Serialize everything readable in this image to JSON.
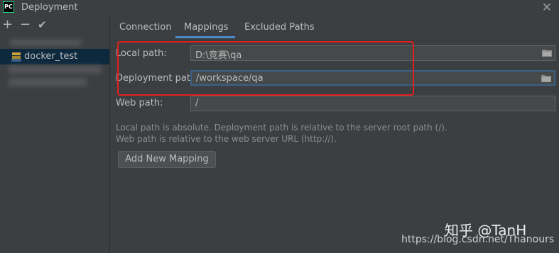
{
  "window": {
    "title": "Deployment",
    "app_icon_text": "PC"
  },
  "left_toolbar": {
    "add": "+",
    "remove": "−",
    "check": "✔"
  },
  "servers": [
    {
      "name": "docker_test",
      "icon": "sftp-icon"
    }
  ],
  "tabs": [
    {
      "label": "Connection",
      "active": false
    },
    {
      "label": "Mappings",
      "active": true
    },
    {
      "label": "Excluded Paths",
      "active": false
    }
  ],
  "form": {
    "local_path": {
      "label": "Local path:",
      "value": "D:\\竞赛\\qa"
    },
    "deployment_path": {
      "label": "Deployment path:",
      "value": "/workspace/qa"
    },
    "web_path": {
      "label": "Web path:",
      "value": "/"
    }
  },
  "hints": [
    "Local path is absolute. Deployment path is relative to the server root path (/).",
    "Web path is relative to the web server URL (http://)."
  ],
  "add_mapping_label": "Add New Mapping",
  "watermarks": {
    "zhihu": "知乎 @TanH",
    "csdn": "https://blog.csdn.net/Thanours"
  },
  "colors": {
    "background": "#3c3f41",
    "field_bg": "#45494a",
    "focus_border": "#3d6185",
    "selection": "#0d293e",
    "annotation": "#e02020"
  }
}
